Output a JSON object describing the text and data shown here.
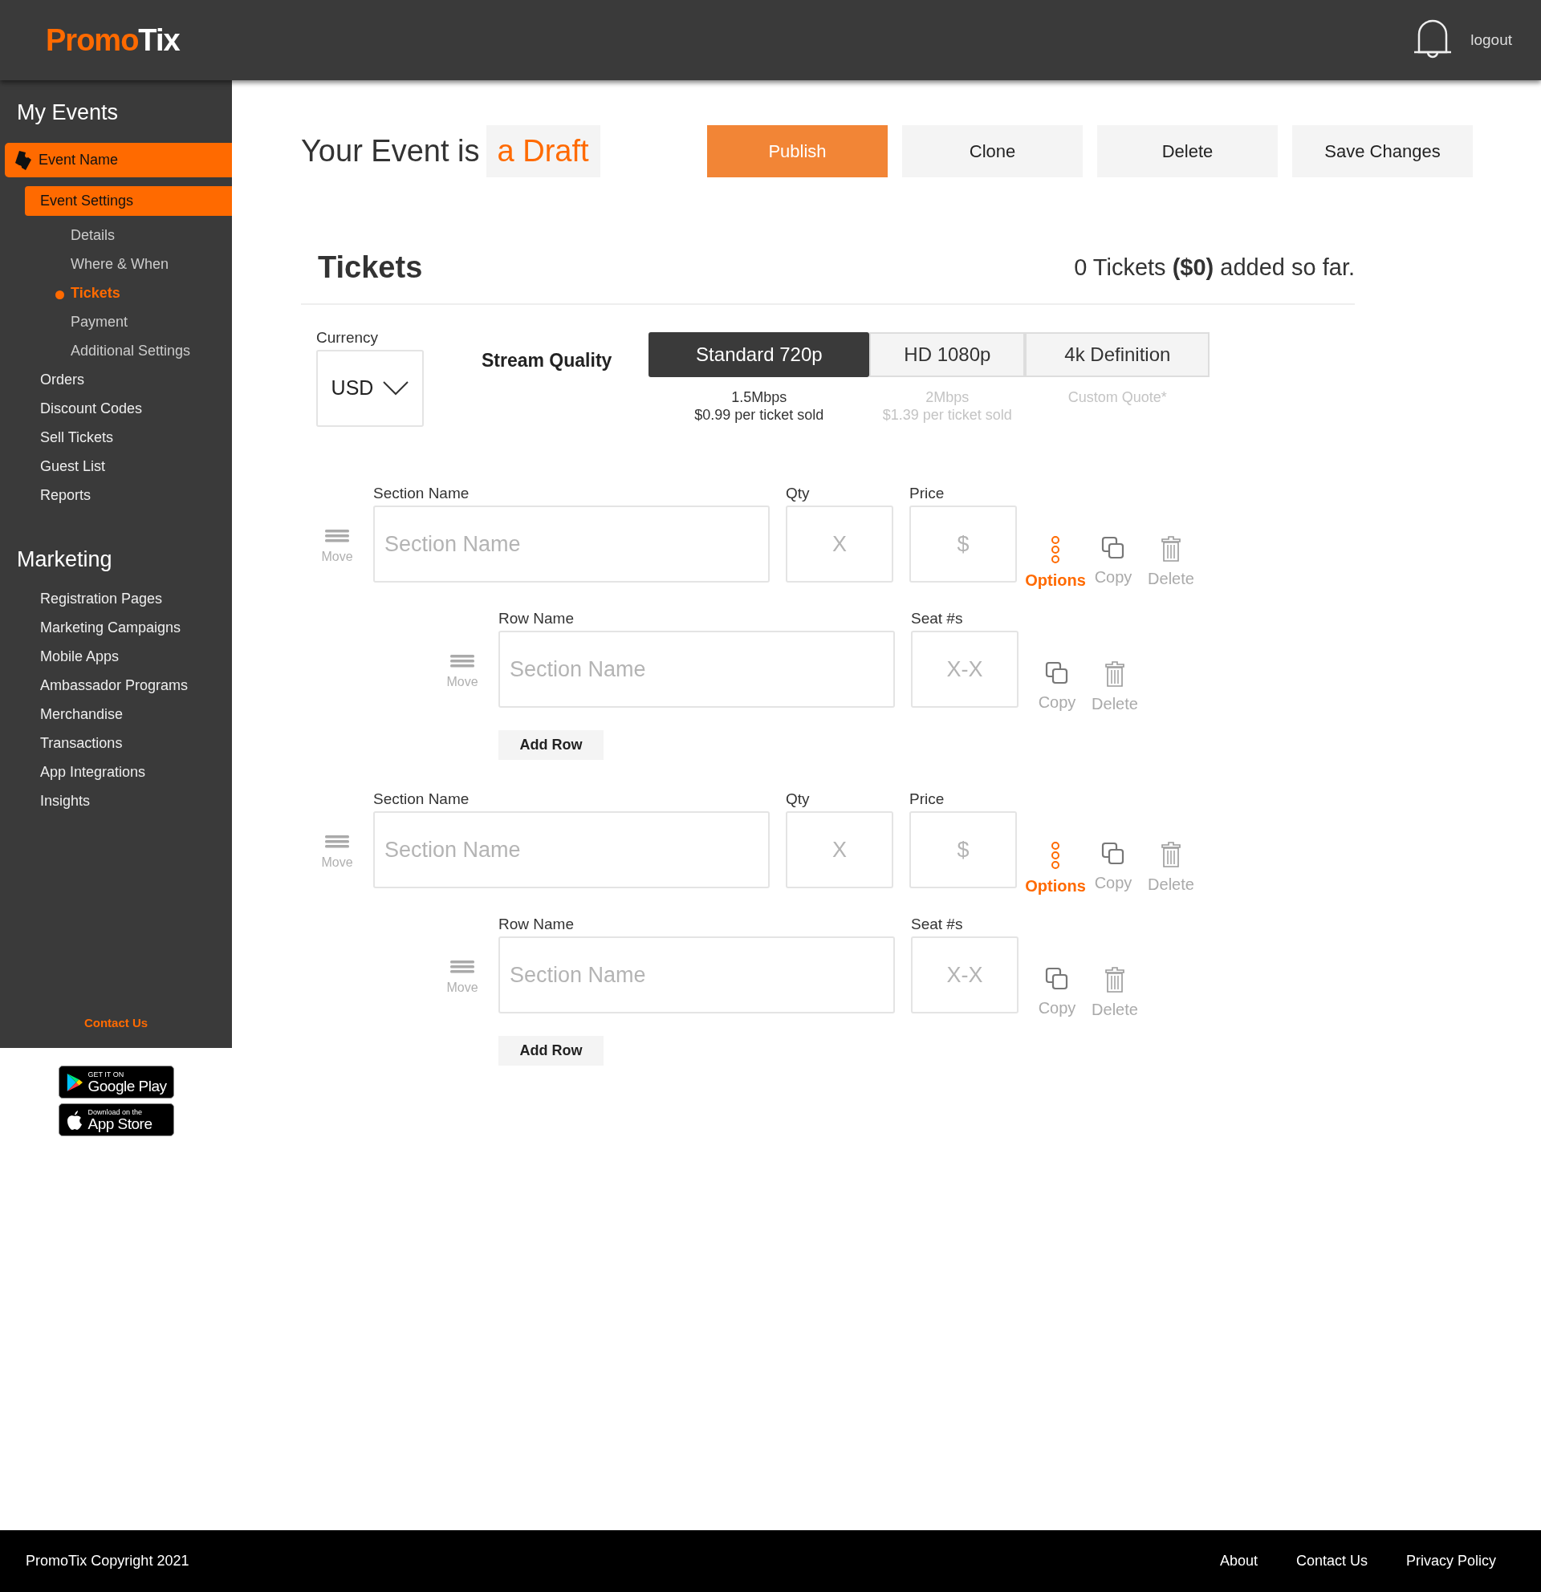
{
  "header": {
    "logo_first": "Promo",
    "logo_second": "Tix",
    "logout": "logout"
  },
  "sidebar": {
    "title": "My Events",
    "nav": [
      {
        "label": "Event Name",
        "selected": true,
        "children": [
          {
            "label": "Event Settings",
            "selected": true,
            "children": [
              {
                "label": "Details",
                "selected": false
              },
              {
                "label": "Where & When",
                "selected": false
              },
              {
                "label": "Tickets",
                "selected": true
              },
              {
                "label": "Payment",
                "selected": false
              },
              {
                "label": "Additional Settings",
                "selected": false
              }
            ]
          },
          {
            "label": "Orders",
            "selected": false
          },
          {
            "label": "Discount Codes",
            "selected": false
          },
          {
            "label": "Sell Tickets",
            "selected": false
          },
          {
            "label": "Guest List",
            "selected": false
          },
          {
            "label": "Reports",
            "selected": false
          }
        ]
      }
    ],
    "marketing_title": "Marketing",
    "marketing": [
      {
        "label": "Registration Pages",
        "selected": false
      },
      {
        "label": "Marketing Campaigns",
        "selected": false
      },
      {
        "label": "Mobile Apps",
        "selected": false
      },
      {
        "label": "Ambassador Programs",
        "selected": false
      },
      {
        "label": "Merchandise",
        "selected": false
      },
      {
        "label": "Transactions",
        "selected": false
      },
      {
        "label": "App Integrations",
        "selected": false
      },
      {
        "label": "Insights",
        "selected": false
      }
    ],
    "contact": "Contact Us"
  },
  "stores": [
    {
      "kind": "google",
      "small": "GET IT ON",
      "big": "Google Play"
    },
    {
      "kind": "apple",
      "small": "Download on the",
      "big": "App Store"
    }
  ],
  "status": {
    "prefix": "Your Event is",
    "value": "a Draft"
  },
  "actions": [
    {
      "label": "Publish",
      "kind": "primary"
    },
    {
      "label": "Clone",
      "kind": "secondary"
    },
    {
      "label": "Delete",
      "kind": "secondary"
    },
    {
      "label": "Save Changes",
      "kind": "secondary"
    }
  ],
  "tickets": {
    "title": "Tickets",
    "summary": "0 Tickets **($0)** added so far."
  },
  "currency": {
    "label": "Currency",
    "value": "USD"
  },
  "stream_quality": {
    "label": "Stream Quality",
    "options": [
      {
        "label": "Standard 720p",
        "selected": true,
        "lines": [
          "1.5Mbps",
          "$0.99 per ticket sold"
        ]
      },
      {
        "label": "HD 1080p",
        "selected": false,
        "lines": [
          "2Mbps",
          "$1.39 per ticket sold"
        ]
      },
      {
        "label": "4k Definition",
        "selected": false,
        "lines": [
          "Custom Quote*"
        ]
      }
    ]
  },
  "sections": [
    {
      "move": "Move",
      "fields": [
        {
          "label": "Section Name",
          "placeholder": "Section Name",
          "kind": "wide"
        },
        {
          "label": "Qty",
          "placeholder": "X",
          "kind": "small"
        },
        {
          "label": "Price",
          "placeholder": "$",
          "kind": "small"
        }
      ],
      "actions": [
        {
          "label": "Options",
          "kind": "options"
        },
        {
          "label": "Copy",
          "kind": "copy"
        },
        {
          "label": "Delete",
          "kind": "delete"
        }
      ],
      "rows": [
        {
          "move": "Move",
          "fields": [
            {
              "label": "Row Name",
              "placeholder": "Section Name",
              "kind": "wide"
            },
            {
              "label": "Seat #s",
              "placeholder": "X-X",
              "kind": "small"
            }
          ],
          "actions": [
            {
              "label": "Copy",
              "kind": "copy"
            },
            {
              "label": "Delete",
              "kind": "delete"
            }
          ]
        }
      ],
      "add_row": "Add Row"
    },
    {
      "move": "Move",
      "fields": [
        {
          "label": "Section Name",
          "placeholder": "Section Name",
          "kind": "wide"
        },
        {
          "label": "Qty",
          "placeholder": "X",
          "kind": "small"
        },
        {
          "label": "Price",
          "placeholder": "$",
          "kind": "small"
        }
      ],
      "actions": [
        {
          "label": "Options",
          "kind": "options"
        },
        {
          "label": "Copy",
          "kind": "copy"
        },
        {
          "label": "Delete",
          "kind": "delete"
        }
      ],
      "rows": [
        {
          "move": "Move",
          "fields": [
            {
              "label": "Row Name",
              "placeholder": "Section Name",
              "kind": "wide"
            },
            {
              "label": "Seat #s",
              "placeholder": "X-X",
              "kind": "small"
            }
          ],
          "actions": [
            {
              "label": "Copy",
              "kind": "copy"
            },
            {
              "label": "Delete",
              "kind": "delete"
            }
          ]
        }
      ],
      "add_row": "Add Row"
    }
  ],
  "footer": {
    "copyright": "PromoTix Copyright 2021",
    "links": [
      "About",
      "Contact Us",
      "Privacy Policy"
    ]
  }
}
